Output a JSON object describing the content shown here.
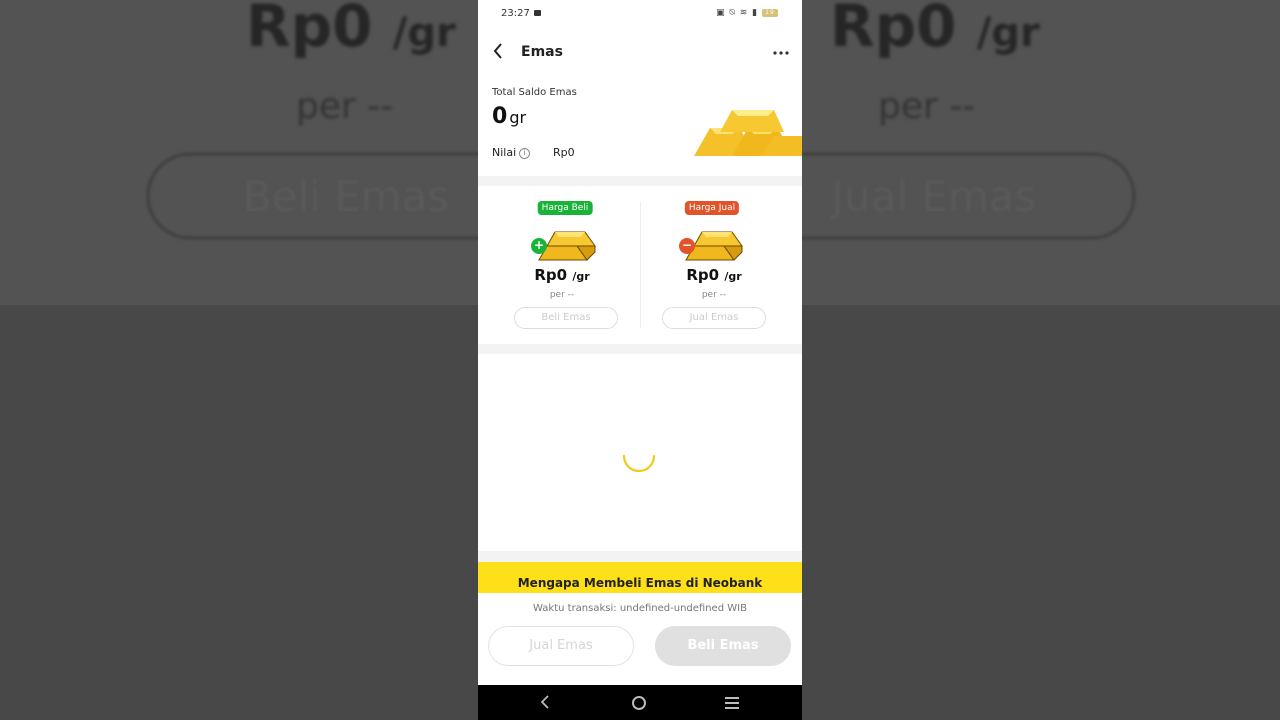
{
  "background": {
    "left": {
      "price": "Rp0",
      "price_unit": "/gr",
      "per": "per --",
      "button": "Beli Emas"
    },
    "right": {
      "price": "Rp0",
      "price_unit": "/gr",
      "per": "per --",
      "button": "Jual Emas"
    }
  },
  "status_bar": {
    "time": "23:27",
    "battery": "19"
  },
  "app_bar": {
    "title": "Emas"
  },
  "saldo": {
    "label": "Total Saldo Emas",
    "amount": "0",
    "unit": "gr",
    "nilai_label": "Nilai",
    "nilai_value": "Rp0"
  },
  "prices": {
    "buy": {
      "badge": "Harga Beli",
      "value": "Rp0",
      "unit": "/gr",
      "per": "per --",
      "button": "Beli Emas"
    },
    "sell": {
      "badge": "Harga Jual",
      "value": "Rp0",
      "unit": "/gr",
      "per": "per --",
      "button": "Jual Emas"
    }
  },
  "banner": {
    "title": "Mengapa Membeli Emas di Neobank"
  },
  "footer": {
    "waktu": "Waktu transaksi: undefined-undefined WIB",
    "jual_button": "Jual Emas",
    "beli_button": "Beli Emas"
  },
  "colors": {
    "accent_yellow": "#fde019",
    "buy_green": "#19b33a",
    "sell_red": "#e2532b",
    "spinner": "#f2c81a"
  },
  "icons": [
    "back-arrow-icon",
    "more-options-icon",
    "info-icon",
    "gold-bars-icon",
    "plus-icon",
    "minus-icon",
    "loading-spinner-icon",
    "nav-back-icon",
    "nav-home-icon",
    "nav-menu-icon"
  ]
}
